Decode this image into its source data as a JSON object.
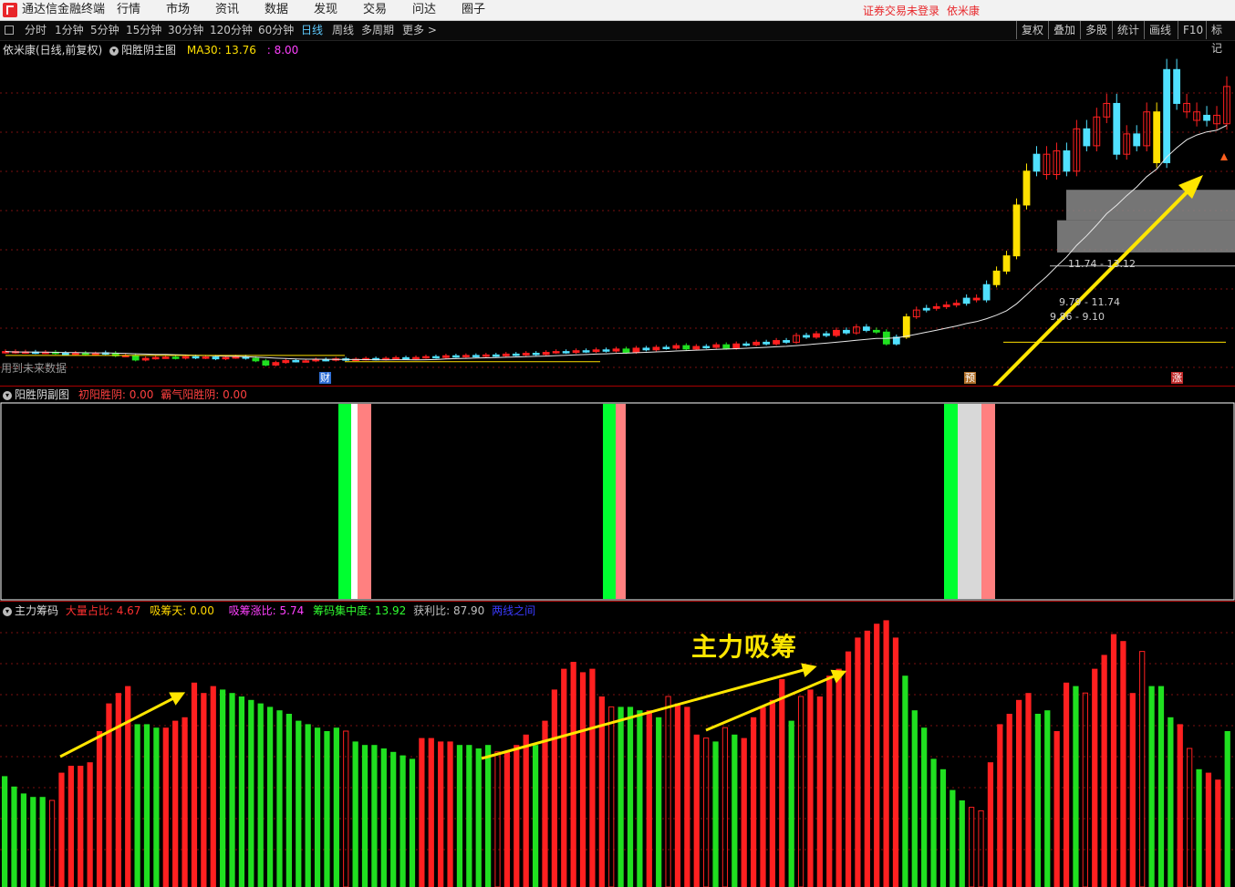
{
  "menubar": {
    "app_title": "通达信金融终端",
    "items": [
      "行情",
      "市场",
      "资讯",
      "数据",
      "发现",
      "交易",
      "问达",
      "圈子"
    ],
    "notice": "证券交易未登录",
    "stock_name": "依米康"
  },
  "toolbar": {
    "periods": [
      "分时",
      "1分钟",
      "5分钟",
      "15分钟",
      "30分钟",
      "120分钟",
      "60分钟",
      "日线",
      "周线",
      "多周期",
      "更多 >"
    ],
    "active_period": "日线",
    "right_buttons": [
      "复权",
      "叠加",
      "多股",
      "统计",
      "画线",
      "F10",
      "标记"
    ]
  },
  "main_panel": {
    "title": "依米康(日线,前复权)",
    "indicator": "阳胜阴主图",
    "ma_label": "MA30: 13.76",
    "extra_value": ": 8.00",
    "future_note": "用到未来数据",
    "markers": [
      {
        "text": "财",
        "color": "#2f6fd6"
      },
      {
        "text": "预",
        "color": "#b0702a"
      },
      {
        "text": "涨",
        "color": "#c02a2a"
      }
    ],
    "zones": [
      {
        "label": "11.74 - 13.12"
      },
      {
        "label": "9.79 - 11.74"
      },
      {
        "label": "9.86 - 9.10"
      }
    ]
  },
  "sub_panel_1": {
    "title": "阳胜阴副图",
    "label1": "初阳胜阴: 0.00",
    "label2": "霸气阳胜阴: 0.00"
  },
  "sub_panel_2": {
    "title": "主力筹码",
    "labels": [
      {
        "text": "大量占比: 4.67",
        "color": "#ff3030"
      },
      {
        "text": "吸筹天: 0.00",
        "color": "#ffd700"
      },
      {
        "text": "吸筹涨比: 5.74",
        "color": "#ff40ff"
      },
      {
        "text": "筹码集中度: 13.92",
        "color": "#30ff30"
      },
      {
        "text": "获利比: 87.90",
        "color": "#c0c0c0"
      },
      {
        "text": "两线之间",
        "color": "#3a3aff"
      }
    ],
    "annotation": "主力吸筹"
  },
  "colors": {
    "up": "#ff2020",
    "down": "#20e020",
    "cyan": "#50e0ff",
    "yellow": "#ffe000",
    "grid": "#7a1010"
  },
  "chip_bars": [
    {
      "v": 0.32,
      "c": "g"
    },
    {
      "v": 0.29,
      "c": "g"
    },
    {
      "v": 0.27,
      "c": "g"
    },
    {
      "v": 0.26,
      "c": "g"
    },
    {
      "v": 0.26,
      "c": "g"
    },
    {
      "v": 0.25,
      "c": "ro"
    },
    {
      "v": 0.33,
      "c": "r"
    },
    {
      "v": 0.35,
      "c": "r"
    },
    {
      "v": 0.35,
      "c": "r"
    },
    {
      "v": 0.36,
      "c": "r"
    },
    {
      "v": 0.45,
      "c": "r"
    },
    {
      "v": 0.53,
      "c": "r"
    },
    {
      "v": 0.56,
      "c": "r"
    },
    {
      "v": 0.58,
      "c": "r"
    },
    {
      "v": 0.47,
      "c": "g"
    },
    {
      "v": 0.47,
      "c": "g"
    },
    {
      "v": 0.46,
      "c": "g"
    },
    {
      "v": 0.46,
      "c": "r"
    },
    {
      "v": 0.48,
      "c": "r"
    },
    {
      "v": 0.49,
      "c": "r"
    },
    {
      "v": 0.59,
      "c": "r"
    },
    {
      "v": 0.56,
      "c": "r"
    },
    {
      "v": 0.58,
      "c": "r"
    },
    {
      "v": 0.57,
      "c": "g"
    },
    {
      "v": 0.56,
      "c": "g"
    },
    {
      "v": 0.55,
      "c": "g"
    },
    {
      "v": 0.54,
      "c": "g"
    },
    {
      "v": 0.53,
      "c": "g"
    },
    {
      "v": 0.52,
      "c": "g"
    },
    {
      "v": 0.51,
      "c": "g"
    },
    {
      "v": 0.5,
      "c": "g"
    },
    {
      "v": 0.48,
      "c": "g"
    },
    {
      "v": 0.47,
      "c": "g"
    },
    {
      "v": 0.46,
      "c": "g"
    },
    {
      "v": 0.45,
      "c": "g"
    },
    {
      "v": 0.46,
      "c": "g"
    },
    {
      "v": 0.45,
      "c": "ro"
    },
    {
      "v": 0.42,
      "c": "g"
    },
    {
      "v": 0.41,
      "c": "g"
    },
    {
      "v": 0.41,
      "c": "g"
    },
    {
      "v": 0.4,
      "c": "g"
    },
    {
      "v": 0.39,
      "c": "g"
    },
    {
      "v": 0.38,
      "c": "g"
    },
    {
      "v": 0.37,
      "c": "g"
    },
    {
      "v": 0.43,
      "c": "r"
    },
    {
      "v": 0.43,
      "c": "r"
    },
    {
      "v": 0.42,
      "c": "r"
    },
    {
      "v": 0.42,
      "c": "r"
    },
    {
      "v": 0.41,
      "c": "g"
    },
    {
      "v": 0.41,
      "c": "g"
    },
    {
      "v": 0.4,
      "c": "g"
    },
    {
      "v": 0.41,
      "c": "g"
    },
    {
      "v": 0.39,
      "c": "ro"
    },
    {
      "v": 0.39,
      "c": "r"
    },
    {
      "v": 0.41,
      "c": "r"
    },
    {
      "v": 0.44,
      "c": "r"
    },
    {
      "v": 0.41,
      "c": "g"
    },
    {
      "v": 0.48,
      "c": "r"
    },
    {
      "v": 0.57,
      "c": "r"
    },
    {
      "v": 0.63,
      "c": "r"
    },
    {
      "v": 0.65,
      "c": "r"
    },
    {
      "v": 0.62,
      "c": "r"
    },
    {
      "v": 0.63,
      "c": "r"
    },
    {
      "v": 0.55,
      "c": "r"
    },
    {
      "v": 0.52,
      "c": "ro"
    },
    {
      "v": 0.52,
      "c": "g"
    },
    {
      "v": 0.52,
      "c": "g"
    },
    {
      "v": 0.51,
      "c": "g"
    },
    {
      "v": 0.51,
      "c": "r"
    },
    {
      "v": 0.49,
      "c": "g"
    },
    {
      "v": 0.55,
      "c": "ro"
    },
    {
      "v": 0.53,
      "c": "r"
    },
    {
      "v": 0.52,
      "c": "r"
    },
    {
      "v": 0.44,
      "c": "r"
    },
    {
      "v": 0.43,
      "c": "ro"
    },
    {
      "v": 0.42,
      "c": "g"
    },
    {
      "v": 0.46,
      "c": "ro"
    },
    {
      "v": 0.44,
      "c": "g"
    },
    {
      "v": 0.43,
      "c": "r"
    },
    {
      "v": 0.49,
      "c": "r"
    },
    {
      "v": 0.52,
      "c": "r"
    },
    {
      "v": 0.54,
      "c": "r"
    },
    {
      "v": 0.6,
      "c": "r"
    },
    {
      "v": 0.48,
      "c": "g"
    },
    {
      "v": 0.55,
      "c": "ro"
    },
    {
      "v": 0.57,
      "c": "r"
    },
    {
      "v": 0.55,
      "c": "r"
    },
    {
      "v": 0.61,
      "c": "r"
    },
    {
      "v": 0.63,
      "c": "r"
    },
    {
      "v": 0.68,
      "c": "r"
    },
    {
      "v": 0.72,
      "c": "r"
    },
    {
      "v": 0.74,
      "c": "r"
    },
    {
      "v": 0.76,
      "c": "r"
    },
    {
      "v": 0.77,
      "c": "r"
    },
    {
      "v": 0.72,
      "c": "r"
    },
    {
      "v": 0.61,
      "c": "g"
    },
    {
      "v": 0.51,
      "c": "g"
    },
    {
      "v": 0.46,
      "c": "g"
    },
    {
      "v": 0.37,
      "c": "g"
    },
    {
      "v": 0.34,
      "c": "g"
    },
    {
      "v": 0.28,
      "c": "g"
    },
    {
      "v": 0.25,
      "c": "g"
    },
    {
      "v": 0.23,
      "c": "ro"
    },
    {
      "v": 0.22,
      "c": "ro"
    },
    {
      "v": 0.36,
      "c": "r"
    },
    {
      "v": 0.47,
      "c": "r"
    },
    {
      "v": 0.5,
      "c": "r"
    },
    {
      "v": 0.54,
      "c": "r"
    },
    {
      "v": 0.56,
      "c": "r"
    },
    {
      "v": 0.5,
      "c": "g"
    },
    {
      "v": 0.51,
      "c": "g"
    },
    {
      "v": 0.45,
      "c": "r"
    },
    {
      "v": 0.59,
      "c": "r"
    },
    {
      "v": 0.58,
      "c": "g"
    },
    {
      "v": 0.56,
      "c": "ro"
    },
    {
      "v": 0.63,
      "c": "r"
    },
    {
      "v": 0.67,
      "c": "r"
    },
    {
      "v": 0.73,
      "c": "r"
    },
    {
      "v": 0.71,
      "c": "r"
    },
    {
      "v": 0.56,
      "c": "r"
    },
    {
      "v": 0.68,
      "c": "ro"
    },
    {
      "v": 0.58,
      "c": "g"
    },
    {
      "v": 0.58,
      "c": "g"
    },
    {
      "v": 0.49,
      "c": "g"
    },
    {
      "v": 0.47,
      "c": "r"
    },
    {
      "v": 0.4,
      "c": "ro"
    },
    {
      "v": 0.34,
      "c": "g"
    },
    {
      "v": 0.33,
      "c": "r"
    },
    {
      "v": 0.31,
      "c": "r"
    },
    {
      "v": 0.45,
      "c": "g"
    }
  ],
  "candles": [
    {
      "o": 4.3,
      "c": 4.35,
      "k": "r"
    },
    {
      "o": 4.35,
      "c": 4.3,
      "k": "r"
    },
    {
      "o": 4.3,
      "c": 4.33,
      "k": "r"
    },
    {
      "o": 4.32,
      "c": 4.28,
      "k": "c"
    },
    {
      "o": 4.28,
      "c": 4.31,
      "k": "r"
    },
    {
      "o": 4.31,
      "c": 4.25,
      "k": "g"
    },
    {
      "o": 4.25,
      "c": 4.22,
      "k": "c"
    },
    {
      "o": 4.22,
      "c": 4.26,
      "k": "r"
    },
    {
      "o": 4.26,
      "c": 4.18,
      "k": "g"
    },
    {
      "o": 4.18,
      "c": 4.22,
      "k": "r"
    },
    {
      "o": 4.2,
      "c": 4.28,
      "k": "c"
    },
    {
      "o": 4.25,
      "c": 4.1,
      "k": "g"
    },
    {
      "o": 4.1,
      "c": 4.12,
      "k": "r"
    },
    {
      "o": 4.12,
      "c": 3.85,
      "k": "g"
    },
    {
      "o": 3.85,
      "c": 3.95,
      "k": "r"
    },
    {
      "o": 3.95,
      "c": 4.0,
      "k": "r"
    },
    {
      "o": 4.0,
      "c": 4.02,
      "k": "r"
    },
    {
      "o": 4.02,
      "c": 3.96,
      "k": "g"
    },
    {
      "o": 3.96,
      "c": 4.05,
      "k": "r"
    },
    {
      "o": 4.05,
      "c": 3.98,
      "k": "c"
    },
    {
      "o": 3.98,
      "c": 4.03,
      "k": "r"
    },
    {
      "o": 4.03,
      "c": 3.92,
      "k": "c"
    },
    {
      "o": 3.92,
      "c": 4.0,
      "k": "r"
    },
    {
      "o": 4.0,
      "c": 4.04,
      "k": "r"
    },
    {
      "o": 4.04,
      "c": 3.95,
      "k": "c"
    },
    {
      "o": 3.95,
      "c": 3.8,
      "k": "g"
    },
    {
      "o": 3.8,
      "c": 3.55,
      "k": "g"
    },
    {
      "o": 3.55,
      "c": 3.7,
      "k": "r"
    },
    {
      "o": 3.7,
      "c": 3.82,
      "k": "r"
    },
    {
      "o": 3.82,
      "c": 3.78,
      "k": "c"
    },
    {
      "o": 3.78,
      "c": 3.8,
      "k": "r"
    },
    {
      "o": 3.8,
      "c": 3.88,
      "k": "r"
    },
    {
      "o": 3.88,
      "c": 3.84,
      "k": "c"
    },
    {
      "o": 3.84,
      "c": 3.92,
      "k": "r"
    },
    {
      "o": 3.92,
      "c": 3.86,
      "k": "c"
    },
    {
      "o": 3.86,
      "c": 3.9,
      "k": "r"
    },
    {
      "o": 3.9,
      "c": 3.94,
      "k": "r"
    },
    {
      "o": 3.94,
      "c": 3.9,
      "k": "c"
    },
    {
      "o": 3.9,
      "c": 3.95,
      "k": "r"
    },
    {
      "o": 3.95,
      "c": 3.99,
      "k": "r"
    },
    {
      "o": 3.99,
      "c": 3.95,
      "k": "c"
    },
    {
      "o": 3.95,
      "c": 4.0,
      "k": "r"
    },
    {
      "o": 4.0,
      "c": 4.05,
      "k": "r"
    },
    {
      "o": 4.05,
      "c": 4.0,
      "k": "c"
    },
    {
      "o": 4.0,
      "c": 4.1,
      "k": "r"
    },
    {
      "o": 4.1,
      "c": 4.05,
      "k": "c"
    },
    {
      "o": 4.05,
      "c": 4.12,
      "k": "r"
    },
    {
      "o": 4.12,
      "c": 4.08,
      "k": "c"
    },
    {
      "o": 4.08,
      "c": 4.15,
      "k": "r"
    },
    {
      "o": 4.15,
      "c": 4.1,
      "k": "c"
    },
    {
      "o": 4.1,
      "c": 4.2,
      "k": "r"
    },
    {
      "o": 4.2,
      "c": 4.15,
      "k": "c"
    },
    {
      "o": 4.15,
      "c": 4.25,
      "k": "r"
    },
    {
      "o": 4.25,
      "c": 4.18,
      "k": "c"
    },
    {
      "o": 4.18,
      "c": 4.3,
      "k": "r"
    },
    {
      "o": 4.3,
      "c": 4.35,
      "k": "r"
    },
    {
      "o": 4.35,
      "c": 4.3,
      "k": "c"
    },
    {
      "o": 4.3,
      "c": 4.4,
      "k": "r"
    },
    {
      "o": 4.4,
      "c": 4.35,
      "k": "c"
    },
    {
      "o": 4.35,
      "c": 4.45,
      "k": "r"
    },
    {
      "o": 4.45,
      "c": 4.38,
      "k": "c"
    },
    {
      "o": 4.38,
      "c": 4.5,
      "k": "r"
    },
    {
      "o": 4.5,
      "c": 4.3,
      "k": "g"
    },
    {
      "o": 4.3,
      "c": 4.55,
      "k": "r"
    },
    {
      "o": 4.55,
      "c": 4.45,
      "k": "c"
    },
    {
      "o": 4.45,
      "c": 4.6,
      "k": "r"
    },
    {
      "o": 4.6,
      "c": 4.55,
      "k": "c"
    },
    {
      "o": 4.55,
      "c": 4.7,
      "k": "r"
    },
    {
      "o": 4.7,
      "c": 4.5,
      "k": "g"
    },
    {
      "o": 4.5,
      "c": 4.65,
      "k": "r"
    },
    {
      "o": 4.65,
      "c": 4.6,
      "k": "c"
    },
    {
      "o": 4.6,
      "c": 4.75,
      "k": "r"
    },
    {
      "o": 4.75,
      "c": 4.55,
      "k": "g"
    },
    {
      "o": 4.55,
      "c": 4.8,
      "k": "r"
    },
    {
      "o": 4.8,
      "c": 4.75,
      "k": "c"
    },
    {
      "o": 4.75,
      "c": 4.9,
      "k": "r"
    },
    {
      "o": 4.9,
      "c": 4.8,
      "k": "c"
    },
    {
      "o": 4.8,
      "c": 5.0,
      "k": "r"
    },
    {
      "o": 5.0,
      "c": 4.9,
      "k": "c"
    },
    {
      "o": 4.9,
      "c": 5.3,
      "k": "r"
    },
    {
      "o": 5.3,
      "c": 5.2,
      "k": "c"
    },
    {
      "o": 5.2,
      "c": 5.4,
      "k": "r"
    },
    {
      "o": 5.4,
      "c": 5.3,
      "k": "c"
    },
    {
      "o": 5.3,
      "c": 5.6,
      "k": "r"
    },
    {
      "o": 5.6,
      "c": 5.45,
      "k": "c"
    },
    {
      "o": 5.45,
      "c": 5.8,
      "k": "r"
    },
    {
      "o": 5.8,
      "c": 5.6,
      "k": "c"
    },
    {
      "o": 5.6,
      "c": 5.5,
      "k": "g"
    },
    {
      "o": 5.5,
      "c": 4.8,
      "k": "g"
    },
    {
      "o": 4.8,
      "c": 5.2,
      "k": "c"
    },
    {
      "o": 5.2,
      "c": 6.4,
      "k": "y"
    },
    {
      "o": 6.4,
      "c": 6.8,
      "k": "r"
    },
    {
      "o": 6.8,
      "c": 6.9,
      "k": "c"
    },
    {
      "o": 6.9,
      "c": 7.0,
      "k": "r"
    },
    {
      "o": 7.0,
      "c": 7.1,
      "k": "r"
    },
    {
      "o": 7.1,
      "c": 7.2,
      "k": "r"
    },
    {
      "o": 7.2,
      "c": 7.5,
      "k": "c"
    },
    {
      "o": 7.5,
      "c": 7.4,
      "k": "r"
    },
    {
      "o": 7.4,
      "c": 8.3,
      "k": "c"
    },
    {
      "o": 8.3,
      "c": 9.1,
      "k": "y"
    },
    {
      "o": 9.1,
      "c": 10.0,
      "k": "y"
    },
    {
      "o": 10.0,
      "c": 13.0,
      "k": "y"
    },
    {
      "o": 13.0,
      "c": 15.0,
      "k": "y"
    },
    {
      "o": 15.0,
      "c": 16.0,
      "k": "c"
    },
    {
      "o": 16.0,
      "c": 14.8,
      "k": "r"
    },
    {
      "o": 14.8,
      "c": 16.2,
      "k": "r"
    },
    {
      "o": 16.2,
      "c": 15.0,
      "k": "c"
    },
    {
      "o": 15.0,
      "c": 17.5,
      "k": "r"
    },
    {
      "o": 17.5,
      "c": 16.5,
      "k": "c"
    },
    {
      "o": 16.5,
      "c": 18.2,
      "k": "r"
    },
    {
      "o": 18.2,
      "c": 19.0,
      "k": "r"
    },
    {
      "o": 19.0,
      "c": 16.0,
      "k": "c"
    },
    {
      "o": 16.0,
      "c": 17.2,
      "k": "r"
    },
    {
      "o": 17.2,
      "c": 16.5,
      "k": "c"
    },
    {
      "o": 16.5,
      "c": 18.5,
      "k": "r"
    },
    {
      "o": 18.5,
      "c": 15.5,
      "k": "y"
    },
    {
      "o": 15.5,
      "c": 21.0,
      "k": "c"
    },
    {
      "o": 21.0,
      "c": 19.0,
      "k": "c"
    },
    {
      "o": 19.0,
      "c": 18.5,
      "k": "r"
    },
    {
      "o": 18.5,
      "c": 18.0,
      "k": "r"
    },
    {
      "o": 18.0,
      "c": 18.3,
      "k": "c"
    },
    {
      "o": 18.3,
      "c": 17.8,
      "k": "r"
    },
    {
      "o": 17.8,
      "c": 20.0,
      "k": "r"
    }
  ]
}
